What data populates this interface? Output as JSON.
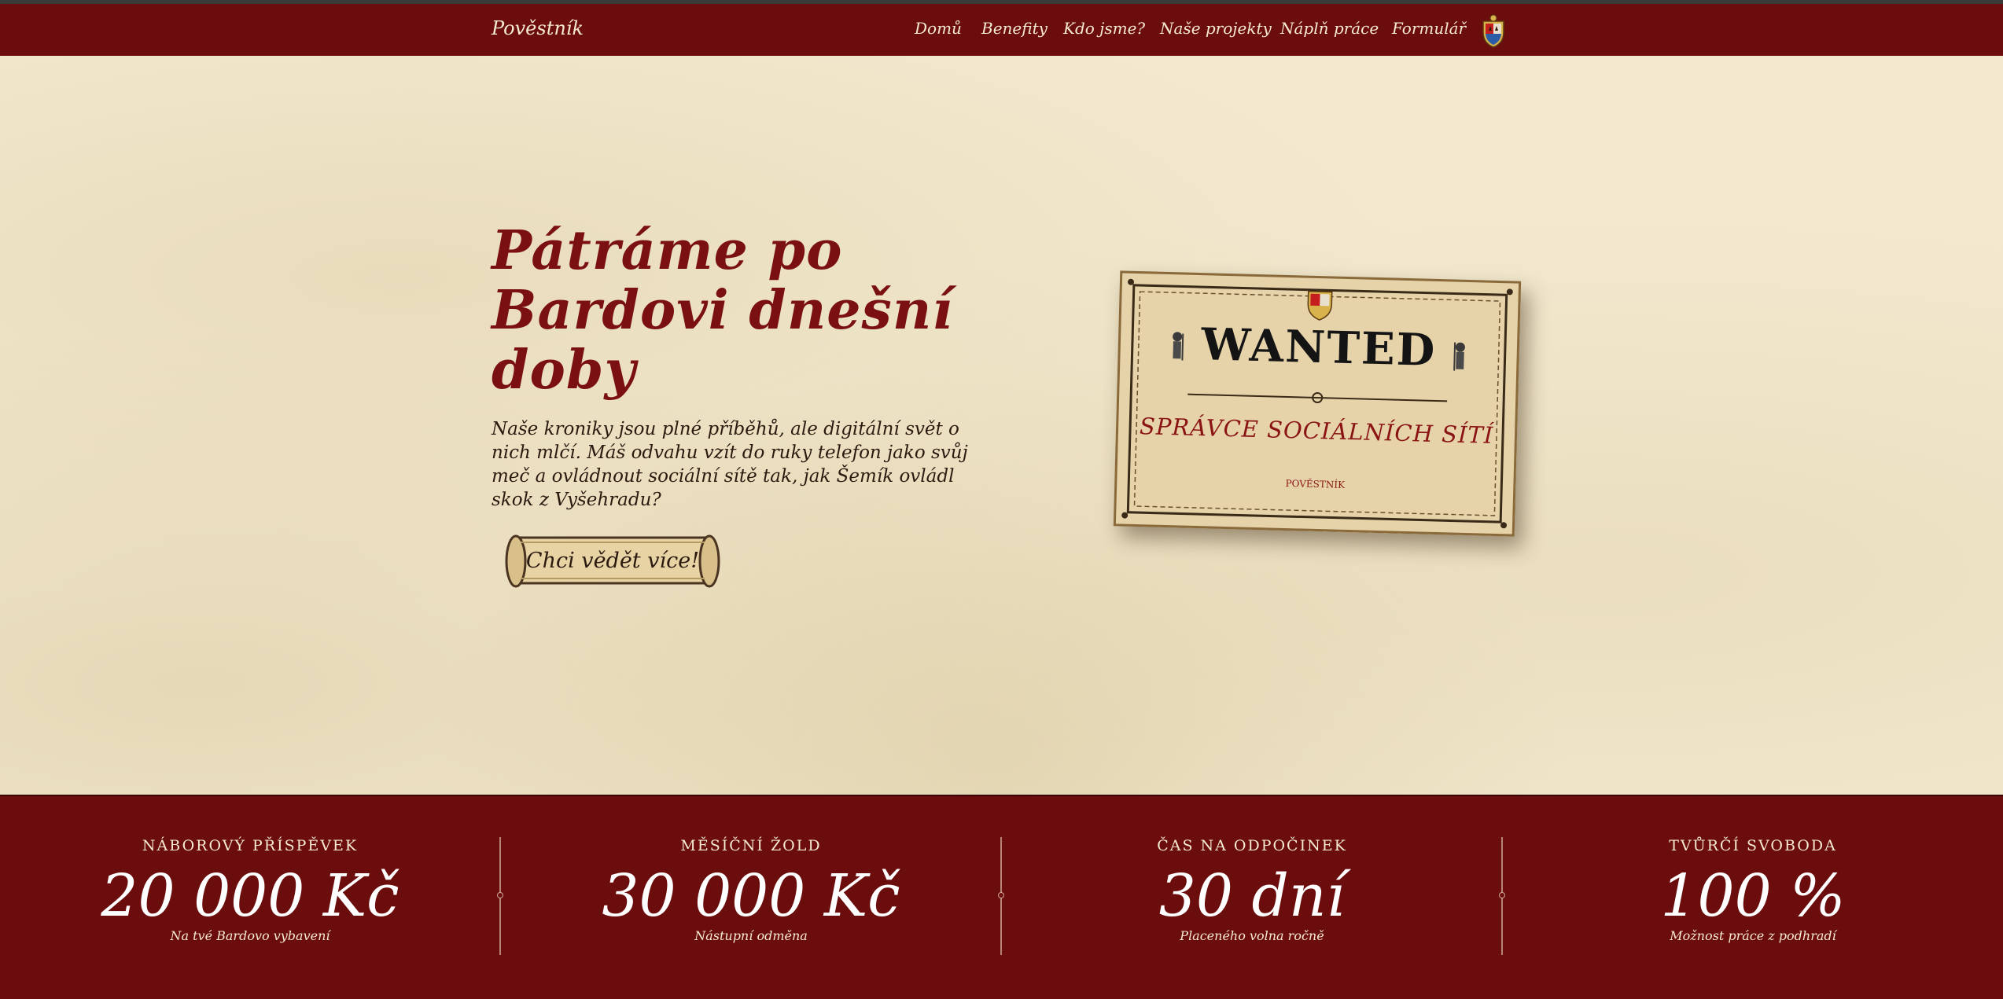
{
  "nav": {
    "brand": "Pověstník",
    "links": [
      "Domů",
      "Benefity",
      "Kdo jsme?",
      "Naše projekty",
      "Náplň práce",
      "Formulář"
    ]
  },
  "hero": {
    "title": "Pátráme po Bardovi dnešní doby",
    "text": "Naše kroniky jsou plné příběhů, ale digitální svět o nich mlčí. Máš odvahu vzít do ruky telefon jako svůj meč a ovládnout sociální sítě tak, jak Šemík ovládl skok z Vyšehradu?",
    "cta_label": "Chci vědět více!"
  },
  "poster": {
    "title": "WANTED",
    "subtitle": "SPRÁVCE SOCIÁLNÍCH SÍTÍ",
    "footer": "POVĚSTNÍK"
  },
  "stats": [
    {
      "label": "NÁBOROVÝ PŘÍSPĚVEK",
      "value": "20 000 Kč",
      "note": "Na tvé Bardovo vybavení"
    },
    {
      "label": "MĚSÍČNÍ ŽOLD",
      "value": "30 000 Kč",
      "note": "Nástupní odměna"
    },
    {
      "label": "ČAS NA ODPOČINEK",
      "value": "30 dní",
      "note": "Placeného volna ročně"
    },
    {
      "label": "TVŮRČÍ SVOBODA",
      "value": "100 %",
      "note": "Možnost práce z podhradí"
    }
  ],
  "colors": {
    "primary": "#6c0d0d",
    "parchment": "#f2e9cf",
    "title": "#7a1010",
    "light_text": "#f5ead2"
  },
  "icons": {
    "crest": "coat-of-arms-icon"
  }
}
